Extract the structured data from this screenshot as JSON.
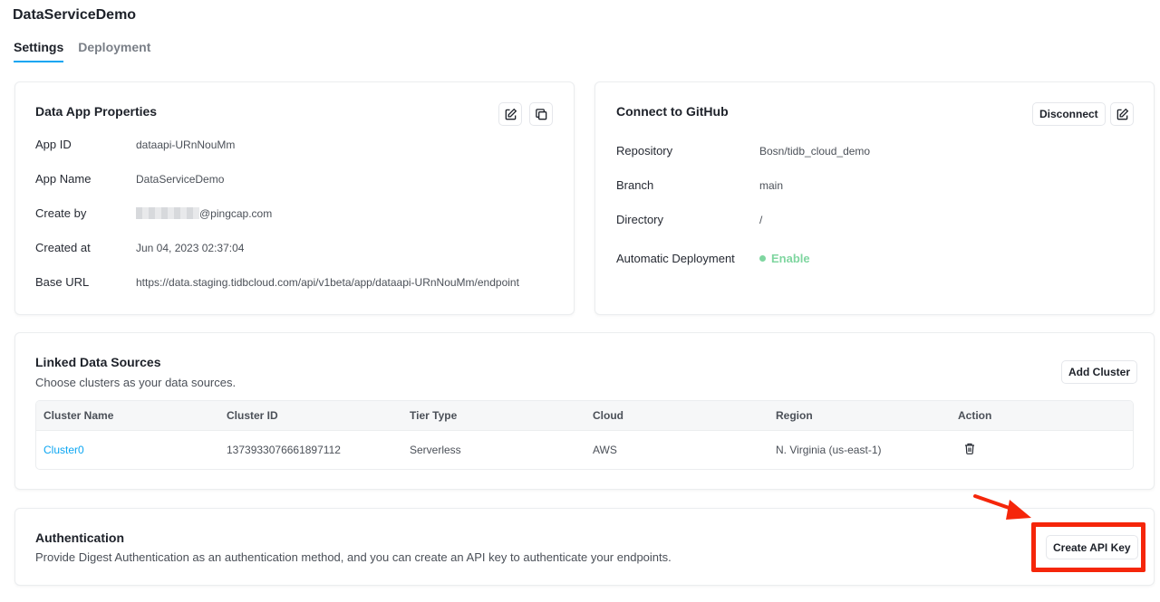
{
  "app": {
    "title": "DataServiceDemo"
  },
  "tabs": [
    {
      "label": "Settings",
      "active": true
    },
    {
      "label": "Deployment",
      "active": false
    }
  ],
  "properties": {
    "title": "Data App Properties",
    "rows": [
      {
        "label": "App ID",
        "value": "dataapi-URnNouMm"
      },
      {
        "label": "App Name",
        "value": "DataServiceDemo"
      },
      {
        "label": "Create by",
        "value": "@pingcap.com"
      },
      {
        "label": "Created at",
        "value": "Jun 04, 2023 02:37:04"
      },
      {
        "label": "Base URL",
        "value": "https://data.staging.tidbcloud.com/api/v1beta/app/dataapi-URnNouMm/endpoint"
      }
    ]
  },
  "github": {
    "title": "Connect to GitHub",
    "disconnect_label": "Disconnect",
    "rows": [
      {
        "label": "Repository",
        "value": "Bosn/tidb_cloud_demo"
      },
      {
        "label": "Branch",
        "value": "main"
      },
      {
        "label": "Directory",
        "value": "/"
      },
      {
        "label": "Automatic Deployment",
        "value": "Enable"
      }
    ]
  },
  "linked": {
    "title": "Linked Data Sources",
    "description": "Choose clusters as your data sources.",
    "add_label": "Add Cluster",
    "columns": [
      "Cluster Name",
      "Cluster ID",
      "Tier Type",
      "Cloud",
      "Region",
      "Action"
    ],
    "rows": [
      {
        "name": "Cluster0",
        "id": "1373933076661897112",
        "tier": "Serverless",
        "cloud": "AWS",
        "region": "N. Virginia (us-east-1)"
      }
    ]
  },
  "auth": {
    "title": "Authentication",
    "description": "Provide Digest Authentication as an authentication method, and you can create an API key to authenticate your endpoints.",
    "create_label": "Create API Key"
  },
  "colors": {
    "accent": "#0ca6f2",
    "highlight": "#f5260a",
    "enable": "#7fd6a0"
  },
  "icons": [
    "edit-icon",
    "copy-icon",
    "trash-icon",
    "arrow-icon"
  ]
}
